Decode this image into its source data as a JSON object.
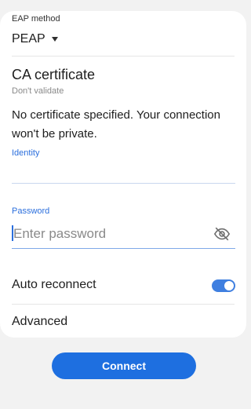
{
  "eap": {
    "label": "EAP method",
    "value": "PEAP"
  },
  "ca_certificate": {
    "title": "CA certificate",
    "subtitle": "Don't validate",
    "warning": "No certificate specified. Your connection won't be private."
  },
  "identity": {
    "label": "Identity",
    "value": ""
  },
  "password": {
    "label": "Password",
    "placeholder": "Enter password",
    "visibility_icon": "eye-off-icon"
  },
  "auto_reconnect": {
    "label": "Auto reconnect",
    "enabled": true
  },
  "advanced": {
    "label": "Advanced"
  },
  "actions": {
    "connect_label": "Connect"
  },
  "colors": {
    "accent": "#1e6fe0",
    "background": "#f2f2f2",
    "card": "#ffffff"
  }
}
